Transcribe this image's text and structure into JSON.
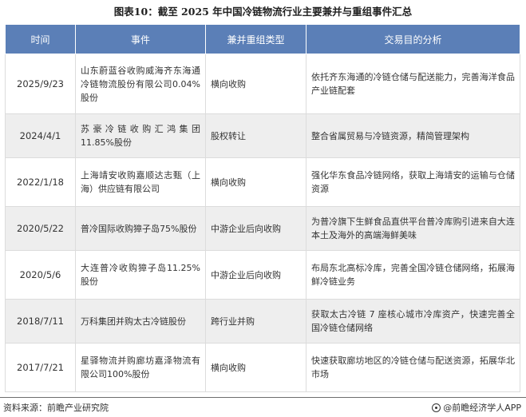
{
  "title": "图表10：截至 2025 年中国冷链物流行业主要兼并与重组事件汇总",
  "table": {
    "headers": [
      "时间",
      "事件",
      "兼并重组类型",
      "交易目的分析"
    ],
    "rows": [
      {
        "date": "2025/9/23",
        "event": "山东蔚蓝谷收购威海齐东海通冷链物流股份有限公司0.04%股份",
        "type": "横向收购",
        "purpose": "依托齐东海通的冷链仓储与配送能力，完善海洋食品产业链配套"
      },
      {
        "date": "2024/4/1",
        "event": "苏豪冷链收购汇鸿集团11.85%股份",
        "type": "股权转让",
        "purpose": "整合省属贸易与冷链资源，精简管理架构"
      },
      {
        "date": "2022/1/18",
        "event": "上海靖安收购嘉顺达志甄（上海）供应链有限公司",
        "type": "横向收购",
        "purpose": "强化华东食品冷链网络，获取上海靖安的运输与仓储资源"
      },
      {
        "date": "2020/5/22",
        "event": "普冷国际收购獐子岛75%股份",
        "type": "中游企业后向收购",
        "purpose": "为普冷旗下生鲜食品直供平台普冷库购引进来自大连本土及海外的高端海鲜美味"
      },
      {
        "date": "2020/5/6",
        "event": "大连普冷收购獐子岛11.25%股份",
        "type": "中游企业后向收购",
        "purpose": "布局东北高标冷库，完善全国冷链仓储网络，拓展海鲜冷链业务"
      },
      {
        "date": "2018/7/11",
        "event": "万科集团并购太古冷链股份",
        "type": "跨行业并购",
        "purpose": "获取太古冷链 7 座核心城市冷库资产，快速完善全国冷链仓储网络"
      },
      {
        "date": "2017/7/21",
        "event": "星驿物流并购廊坊嘉泽物流有限公司100%股份",
        "type": "横向收购",
        "purpose": "快速获取廊坊地区的冷链仓储与配送资源，拓展华北市场"
      }
    ]
  },
  "footer": {
    "source": "资料来源：前瞻产业研究院",
    "brand": "@前瞻经济学人APP",
    "brand_icon": "circle-logo-icon"
  },
  "colors": {
    "header_bg": "#5b7fb7",
    "row_alt_bg": "#eeeeee",
    "border": "#dcdcdc"
  }
}
